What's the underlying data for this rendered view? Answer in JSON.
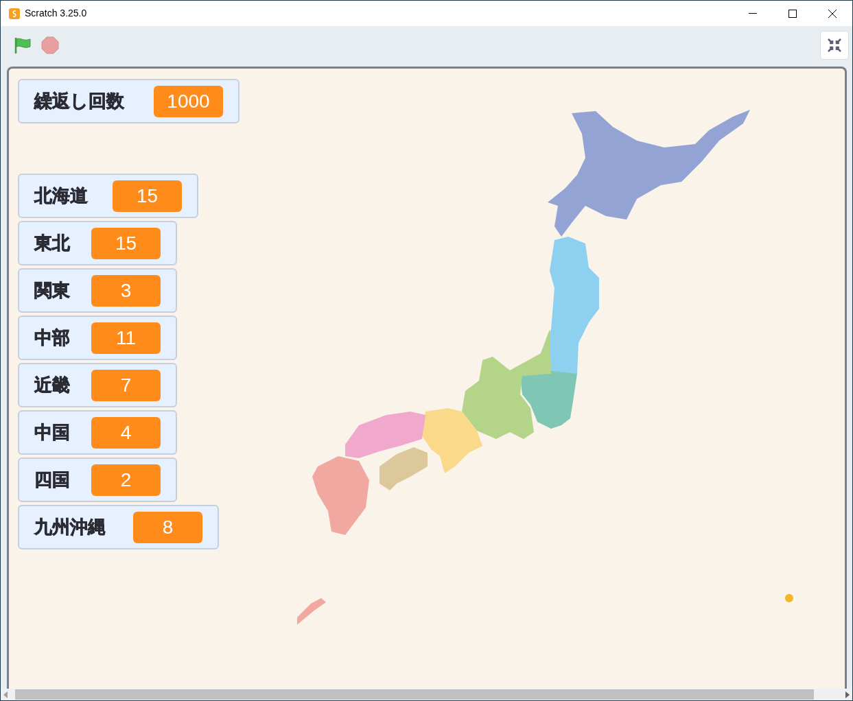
{
  "window": {
    "title": "Scratch 3.25.0"
  },
  "monitors": [
    {
      "label": "繰返し回数",
      "value": "1000"
    },
    {
      "label": "北海道",
      "value": "15"
    },
    {
      "label": "東北",
      "value": "15"
    },
    {
      "label": "関東",
      "value": "3"
    },
    {
      "label": "中部",
      "value": "11"
    },
    {
      "label": "近畿",
      "value": "7"
    },
    {
      "label": "中国",
      "value": "4"
    },
    {
      "label": "四国",
      "value": "2"
    },
    {
      "label": "九州沖縄",
      "value": "8"
    }
  ]
}
